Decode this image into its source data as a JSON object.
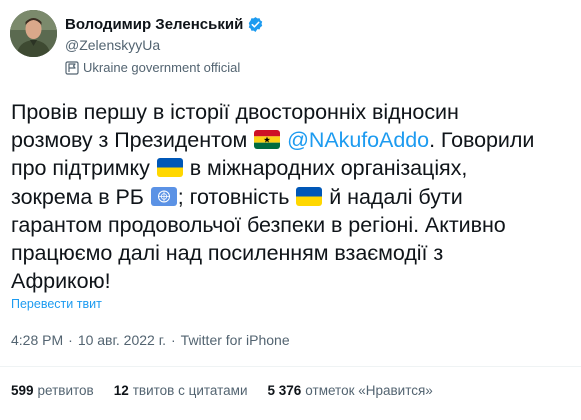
{
  "author": {
    "name": "Володимир Зеленський",
    "handle": "@ZelenskyyUa",
    "label": "Ukraine government official",
    "avatar_icon": "avatar-photo",
    "verified_icon": "verified-badge-icon",
    "label_icon": "government-flag-icon"
  },
  "tweet": {
    "lines": [
      [
        "Провів першу в історії двосторонніх відносин"
      ],
      [
        "розмову з Президентом ",
        "@NAkufoAddo",
        ". Говорили"
      ],
      [
        "про підтримку ",
        " в міжнародних організаціях,"
      ],
      [
        "зокрема в РБ ",
        "; готовність ",
        " й надалі бути"
      ],
      [
        "гарантом продовольчої безпеки в регіоні. Активно"
      ],
      [
        "працюємо далі над посиленням взаємодії з"
      ],
      [
        "Африкою!"
      ]
    ],
    "emojis": [
      "ghana-flag-emoji",
      "ukraine-flag-emoji",
      "un-flag-emoji",
      "ukraine-flag-emoji"
    ],
    "translate_link": "Перевести твит"
  },
  "meta": {
    "time": "4:28 PM",
    "separator": "·",
    "date": "10 авг. 2022 г.",
    "source": "Twitter for iPhone"
  },
  "stats": {
    "retweets_count": "599",
    "retweets_label": "ретвитов",
    "quotes_count": "12",
    "quotes_label": "твитов с цитатами",
    "likes_count": "5 376",
    "likes_label": "отметок «Нравится»"
  },
  "colors": {
    "link": "#1d9bf0",
    "secondary_text": "#536471",
    "primary_text": "#0f1419",
    "divider": "#eff3f4"
  }
}
